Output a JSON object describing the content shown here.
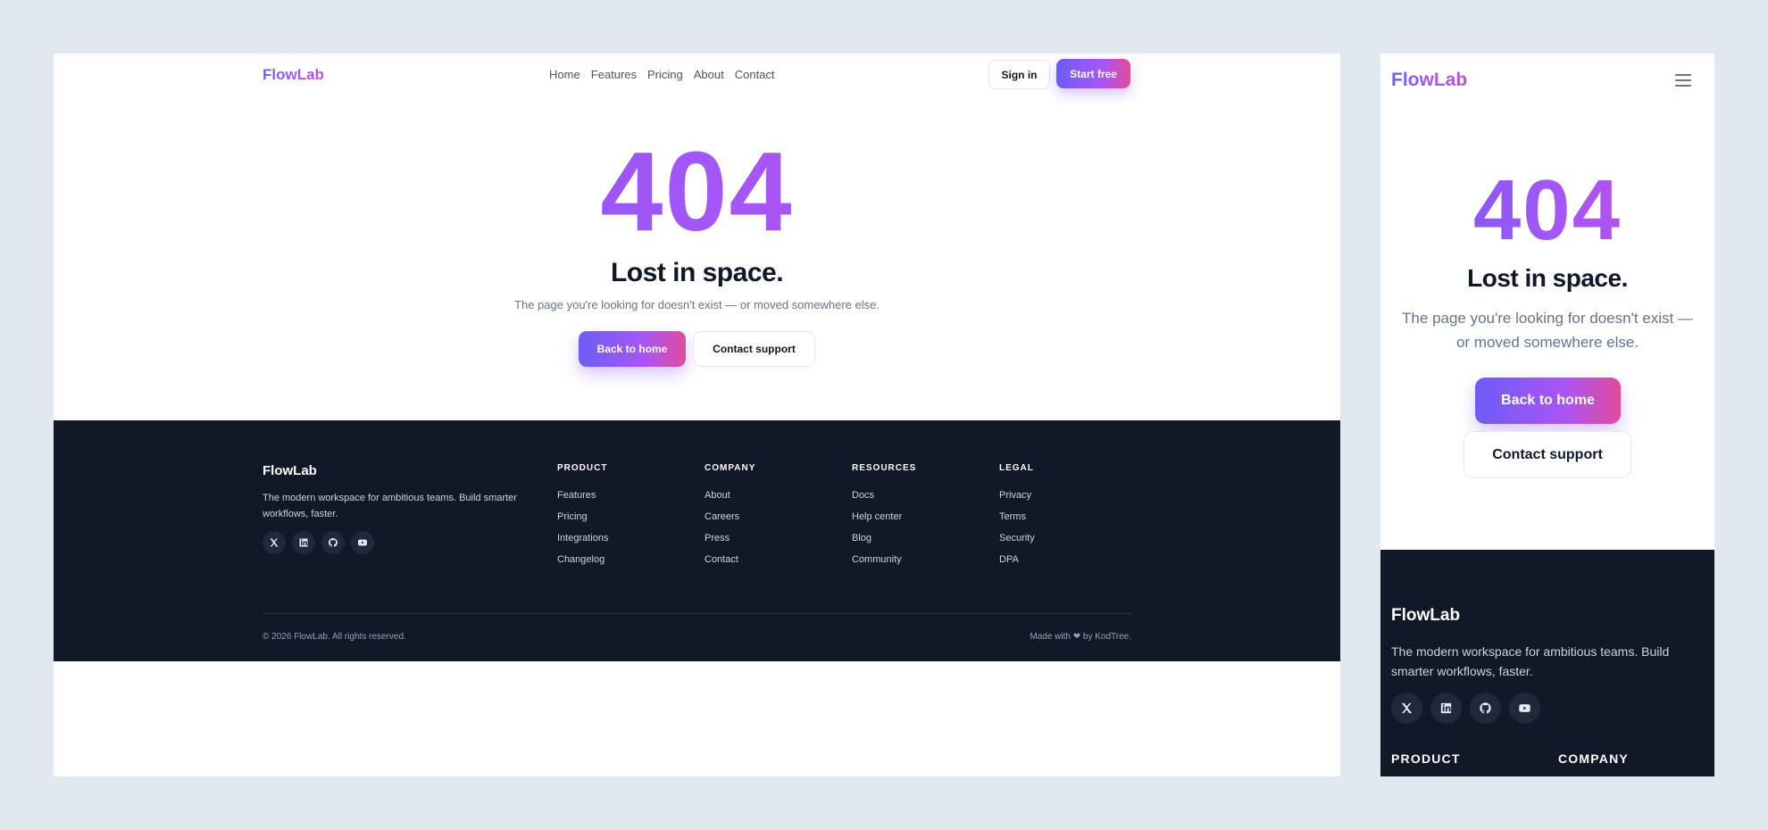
{
  "brand": {
    "name": "FlowLab"
  },
  "nav": {
    "links": [
      "Home",
      "Features",
      "Pricing",
      "About",
      "Contact"
    ],
    "sign_in": "Sign in",
    "start_free": "Start free"
  },
  "hero": {
    "code": "404",
    "title": "Lost in space.",
    "subtitle": "The page you're looking for doesn't exist — or moved somewhere else.",
    "primary_cta": "Back to home",
    "secondary_cta": "Contact support"
  },
  "footer": {
    "brand": "FlowLab",
    "description": "The modern workspace for ambitious teams. Build smarter workflows, faster.",
    "socials": [
      "x-icon",
      "linkedin-icon",
      "github-icon",
      "youtube-icon"
    ],
    "columns": [
      {
        "title": "PRODUCT",
        "links": [
          "Features",
          "Pricing",
          "Integrations",
          "Changelog"
        ]
      },
      {
        "title": "COMPANY",
        "links": [
          "About",
          "Careers",
          "Press",
          "Contact"
        ]
      },
      {
        "title": "RESOURCES",
        "links": [
          "Docs",
          "Help center",
          "Blog",
          "Community"
        ]
      },
      {
        "title": "LEGAL",
        "links": [
          "Privacy",
          "Terms",
          "Security",
          "DPA"
        ]
      }
    ],
    "copyright": "© 2026 FlowLab. All rights reserved.",
    "made_with": "Made with ❤ by KodTree."
  },
  "colors": {
    "accent_start": "#6d5cf6",
    "accent_mid": "#a855f7",
    "accent_end": "#e04c9c",
    "footer_bg": "#111827",
    "canvas_bg": "#e2e8f0"
  }
}
